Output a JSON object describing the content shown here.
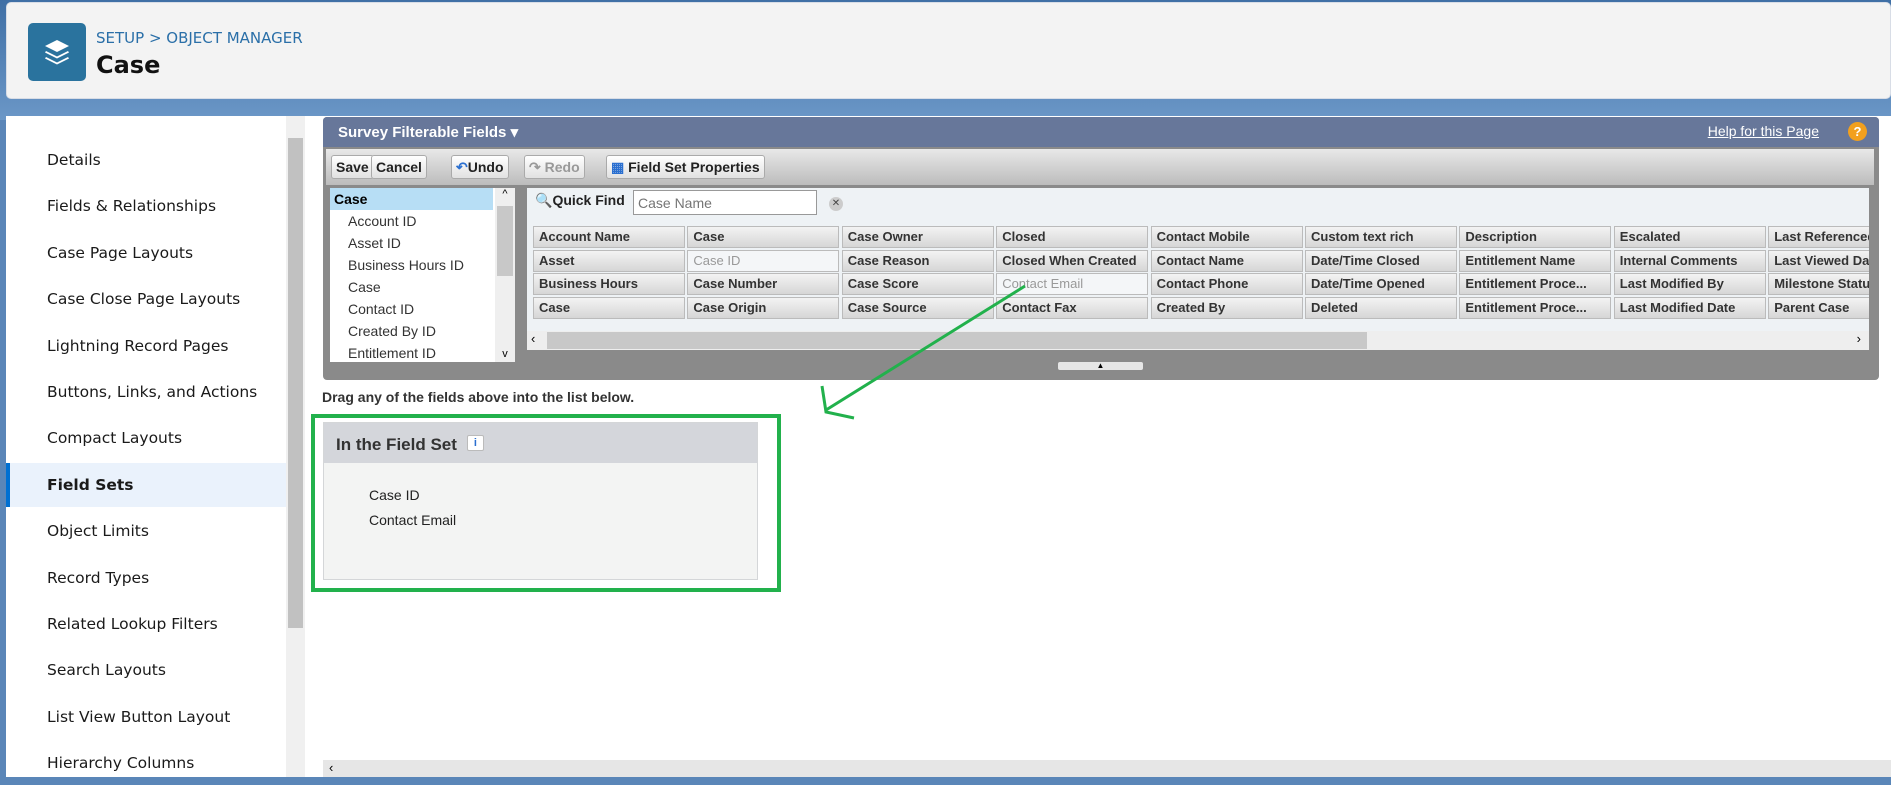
{
  "header": {
    "breadcrumb": "SETUP > OBJECT MANAGER",
    "title": "Case",
    "icon": "layers-icon",
    "icon_color": "#2a739e"
  },
  "sidebar": {
    "items": [
      "Details",
      "Fields & Relationships",
      "Case Page Layouts",
      "Case Close Page Layouts",
      "Lightning Record Pages",
      "Buttons, Links, and Actions",
      "Compact Layouts",
      "Field Sets",
      "Object Limits",
      "Record Types",
      "Related Lookup Filters",
      "Search Layouts",
      "List View Button Layout",
      "Hierarchy Columns"
    ],
    "active": "Field Sets"
  },
  "builder": {
    "title": "Survey Filterable Fields",
    "help": "Help for this Page",
    "toolbar": {
      "save": "Save",
      "cancel": "Cancel",
      "undo": "Undo",
      "redo": "Redo",
      "properties": "Field Set Properties"
    },
    "tree": {
      "root": "Case",
      "items": [
        "Account ID",
        "Asset ID",
        "Business Hours ID",
        "Case",
        "Contact ID",
        "Created By ID",
        "Entitlement ID"
      ]
    },
    "quick_find": {
      "label": "Quick Find",
      "placeholder": "Case Name"
    },
    "columns": [
      [
        "Account Name",
        "Asset",
        "Business Hours",
        "Case"
      ],
      [
        "Case",
        "Case ID",
        "Case Number",
        "Case Origin"
      ],
      [
        "Case Owner",
        "Case Reason",
        "Case Score",
        "Case Source"
      ],
      [
        "Closed",
        "Closed When Created",
        "Contact Email",
        "Contact Fax"
      ],
      [
        "Contact Mobile",
        "Contact Name",
        "Contact Phone",
        "Created By"
      ],
      [
        "Custom text rich",
        "Date/Time Closed",
        "Date/Time Opened",
        "Deleted"
      ],
      [
        "Description",
        "Entitlement Name",
        "Entitlement Proce...",
        "Entitlement Proce..."
      ],
      [
        "Escalated",
        "Internal Comments",
        "Last Modified By",
        "Last Modified Date"
      ],
      [
        "Last Referenced",
        "Last Viewed Date",
        "Milestone Status",
        "Parent Case"
      ]
    ],
    "used_fields": [
      "Case ID",
      "Contact Email"
    ]
  },
  "instruction": "Drag any of the fields above into the list below.",
  "field_set": {
    "title": "In the Field Set",
    "items": [
      "Case ID",
      "Contact Email"
    ]
  },
  "annotation_color": "#22b14c"
}
